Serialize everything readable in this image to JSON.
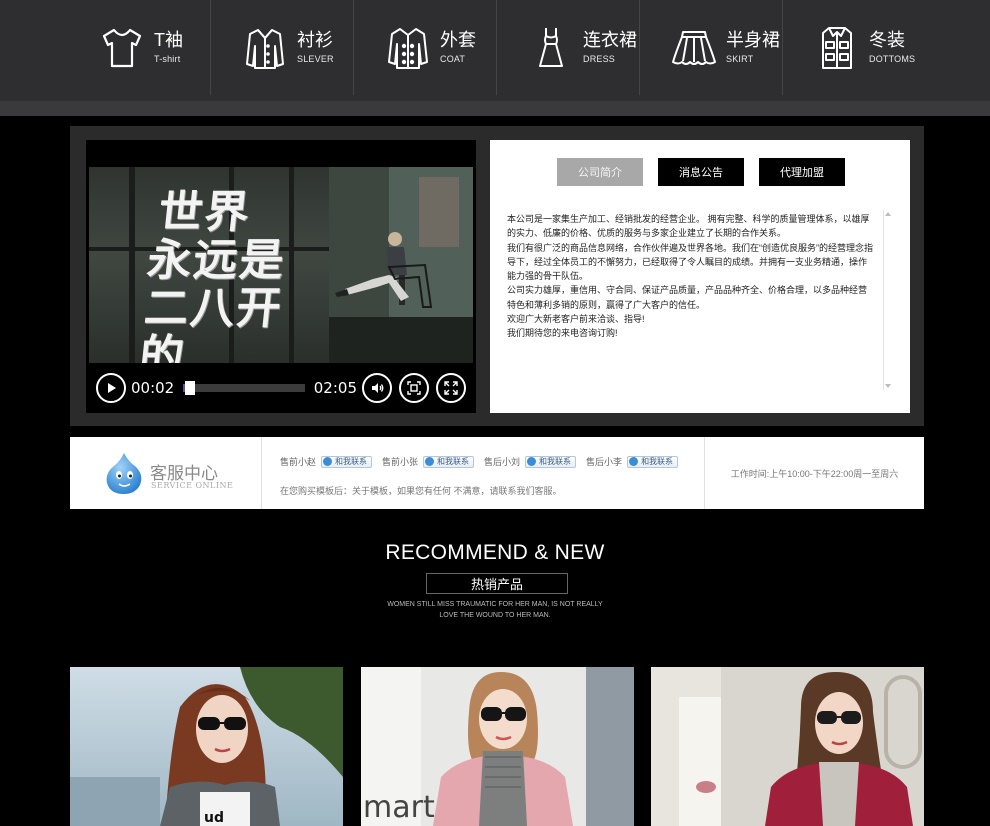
{
  "nav": {
    "items": [
      {
        "cn": "T袖",
        "en": "T-shirt",
        "icon": "tshirt-icon"
      },
      {
        "cn": "衬衫",
        "en": "SLEVER",
        "icon": "shirt-icon"
      },
      {
        "cn": "外套",
        "en": "COAT",
        "icon": "coat-icon"
      },
      {
        "cn": "连衣裙",
        "en": "DRESS",
        "icon": "dress-icon"
      },
      {
        "cn": "半身裙",
        "en": "SKIRT",
        "icon": "skirt-icon"
      },
      {
        "cn": "冬装",
        "en": "DOTTOMS",
        "icon": "winter-coat-icon"
      }
    ]
  },
  "video": {
    "overlay_text": [
      "世界",
      "永远是",
      "二八开的"
    ],
    "current_time": "00:02",
    "total_time": "02:05",
    "progress": 0.016
  },
  "info": {
    "tabs": [
      {
        "label": "公司简介",
        "active": true
      },
      {
        "label": "消息公告",
        "active": false
      },
      {
        "label": "代理加盟",
        "active": false
      }
    ],
    "paragraphs": [
      "本公司是一家集生产加工、经销批发的经营企业。 拥有完整、科学的质量管理体系，以雄厚的实力、低廉的价格、优质的服务与多家企业建立了长期的合作关系。",
      "我们有很广泛的商品信息网络，合作伙伴遍及世界各地。我们在“创造优良服务”的经营理念指导下，经过全体员工的不懈努力，已经取得了令人瞩目的成绩。并拥有一支业务精通，操作能力强的骨干队伍。",
      "公司实力雄厚，重信用、守合同、保证产品质量，产品品种齐全、价格合理，以多品种经营特色和薄利多销的原则，赢得了广大客户的信任。",
      "欢迎广大新老客户前来洽谈、指导!",
      "我们期待您的来电咨询订购!"
    ]
  },
  "service": {
    "title": "客服中心",
    "subtitle": "SERVICE ONLINE",
    "agents": [
      {
        "name": "售前小赵",
        "button": "和我联系"
      },
      {
        "name": "售前小张",
        "button": "和我联系"
      },
      {
        "name": "售后小刘",
        "button": "和我联系"
      },
      {
        "name": "售后小李",
        "button": "和我联系"
      }
    ],
    "note": "在您购买模板后：关于模板，如果您有任何 不满意，请联系我们客服。",
    "hours": "工作时间:上午10:00-下午22:00周一至周六"
  },
  "recommend": {
    "title": "RECOMMEND & NEW",
    "subtitle": "热销产品",
    "desc_line1": "WOMEN STILL MISS TRAUMATIC FOR HER MAN, IS NOT REALLY",
    "desc_line2": "LOVE THE WOUND TO HER MAN."
  },
  "products": {
    "card2_sign_text": "mart Ar"
  },
  "colors": {
    "nav_bg": "#2e2e30",
    "panel_bg": "#2b2b2b",
    "page_bg": "#000000",
    "progress_accent": "#6a4aa0",
    "service_icon_blue": "#3a8ed8"
  }
}
